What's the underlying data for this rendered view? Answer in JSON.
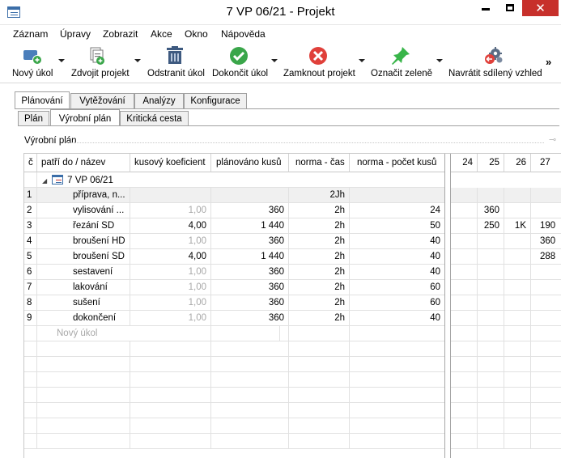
{
  "window": {
    "title": "7 VP 06/21 - Projekt",
    "close_glyph": "✕"
  },
  "menu": [
    "Záznam",
    "Úpravy",
    "Zobrazit",
    "Akce",
    "Okno",
    "Nápověda"
  ],
  "toolbar": {
    "buttons": [
      {
        "label": "Nový úkol",
        "icon": "new-task-icon"
      },
      {
        "label": "Zdvojit projekt",
        "icon": "duplicate-project-icon"
      },
      {
        "label": "Odstranit úkol",
        "icon": "trash-icon"
      },
      {
        "label": "Dokončit úkol",
        "icon": "check-icon"
      },
      {
        "label": "Zamknout projekt",
        "icon": "lock-cross-icon"
      },
      {
        "label": "Označit zeleně",
        "icon": "green-pin-icon"
      },
      {
        "label": "Navrátit sdílený vzhled",
        "icon": "gear-reset-icon"
      }
    ],
    "overflow": "»"
  },
  "tabs_primary": [
    "Plánování",
    "Vytěžování",
    "Analýzy",
    "Konfigurace"
  ],
  "tabs_secondary": [
    "Plán",
    "Výrobní plán",
    "Kritická cesta"
  ],
  "section_title": "Výrobní plán",
  "grid": {
    "columns": [
      "č",
      "patří do / název",
      "kusový koeficient",
      "plánováno kusů",
      "norma - čas",
      "norma - počet kusů"
    ],
    "day_columns": [
      "24",
      "25",
      "26",
      "27"
    ],
    "project_row": "7 VP 06/21",
    "rows": [
      {
        "n": "1",
        "name": "příprava, n...",
        "koef": "",
        "plan": "",
        "cas": "2Jh",
        "pocet": "",
        "days": [
          "",
          "",
          "",
          ""
        ]
      },
      {
        "n": "2",
        "name": "vylisování ...",
        "koef": "1,00",
        "plan": "360",
        "cas": "2h",
        "pocet": "24",
        "days": [
          "",
          "360",
          "",
          ""
        ]
      },
      {
        "n": "3",
        "name": "řezání SD",
        "koef": "4,00",
        "plan": "1 440",
        "cas": "2h",
        "pocet": "50",
        "days": [
          "",
          "250",
          "1K",
          "190"
        ]
      },
      {
        "n": "4",
        "name": "broušení HD",
        "koef": "1,00",
        "plan": "360",
        "cas": "2h",
        "pocet": "40",
        "days": [
          "",
          "",
          "",
          "360"
        ]
      },
      {
        "n": "5",
        "name": "broušení SD",
        "koef": "4,00",
        "plan": "1 440",
        "cas": "2h",
        "pocet": "40",
        "days": [
          "",
          "",
          "",
          "288"
        ]
      },
      {
        "n": "6",
        "name": "sestavení",
        "koef": "1,00",
        "plan": "360",
        "cas": "2h",
        "pocet": "40",
        "days": [
          "",
          "",
          "",
          ""
        ]
      },
      {
        "n": "7",
        "name": "lakování",
        "koef": "1,00",
        "plan": "360",
        "cas": "2h",
        "pocet": "60",
        "days": [
          "",
          "",
          "",
          ""
        ]
      },
      {
        "n": "8",
        "name": "sušení",
        "koef": "1,00",
        "plan": "360",
        "cas": "2h",
        "pocet": "60",
        "days": [
          "",
          "",
          "",
          ""
        ]
      },
      {
        "n": "9",
        "name": "dokončení",
        "koef": "1,00",
        "plan": "360",
        "cas": "2h",
        "pocet": "40",
        "days": [
          "",
          "",
          "",
          ""
        ]
      }
    ],
    "new_task_placeholder": "Nový úkol"
  }
}
